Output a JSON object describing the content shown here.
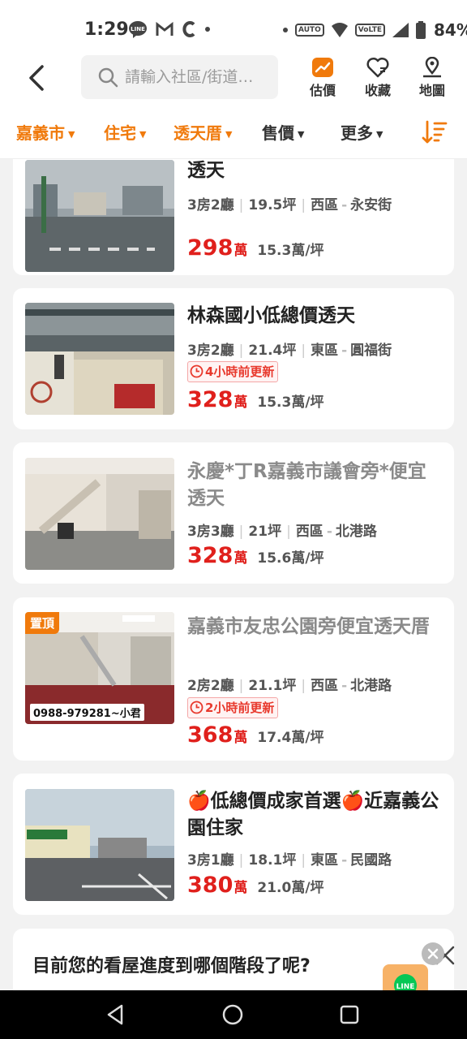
{
  "status_bar": {
    "time": "1:29",
    "battery": "84%",
    "icons": [
      "line-icon",
      "gmail-icon",
      "c-icon",
      "dot-icon",
      "auto-icon",
      "wifi-icon",
      "volte-icon",
      "signal-icon",
      "battery-icon"
    ],
    "chips": {
      "auto": "AUTO",
      "volte": "VoLTE"
    }
  },
  "topbar": {
    "search_placeholder": "請輸入社區/街道…",
    "actions": [
      {
        "label": "估價",
        "icon": "valuation-icon"
      },
      {
        "label": "收藏",
        "icon": "favorite-heart-icon"
      },
      {
        "label": "地圖",
        "icon": "map-pin-icon"
      }
    ]
  },
  "filters": [
    {
      "label": "嘉義市",
      "active": true
    },
    {
      "label": "住宅",
      "active": true
    },
    {
      "label": "透天厝",
      "active": true
    },
    {
      "label": "售價",
      "active": false
    },
    {
      "label": "更多",
      "active": false
    }
  ],
  "listings": [
    {
      "title": "透天",
      "rooms": "3房2廳",
      "area": "19.5坪",
      "district": "西區",
      "street": "永安街",
      "price": "298",
      "price_unit": "萬",
      "unit_price": "15.3萬/坪"
    },
    {
      "title": "林森國小低總價透天",
      "rooms": "3房2廳",
      "area": "21.4坪",
      "district": "東區",
      "street": "圓福街",
      "updated": "4小時前更新",
      "price": "328",
      "price_unit": "萬",
      "unit_price": "15.3萬/坪"
    },
    {
      "title": "永慶*丁R嘉義市議會旁*便宜透天",
      "rooms": "3房3廳",
      "area": "21坪",
      "district": "西區",
      "street": "北港路",
      "price": "328",
      "price_unit": "萬",
      "unit_price": "15.6萬/坪"
    },
    {
      "title": "嘉義市友忠公園旁便宜透天厝",
      "rooms": "2房2廳",
      "area": "21.1坪",
      "district": "西區",
      "street": "北港路",
      "updated": "2小時前更新",
      "badge": "置頂",
      "photo_text": "0988-979281~小君",
      "price": "368",
      "price_unit": "萬",
      "unit_price": "17.4萬/坪"
    },
    {
      "title": "🍎低總價成家首選🍎近嘉義公園住家",
      "rooms": "3房1廳",
      "area": "18.1坪",
      "district": "東區",
      "street": "民國路",
      "price": "380",
      "price_unit": "萬",
      "unit_price": "21.0萬/坪"
    }
  ],
  "survey": {
    "question": "目前您的看屋進度到哪個階段了呢?",
    "promo_label": "LINE"
  },
  "colors": {
    "accent_orange": "#f07a0c",
    "price_red": "#e0201c",
    "tag_red": "#e8392d"
  }
}
